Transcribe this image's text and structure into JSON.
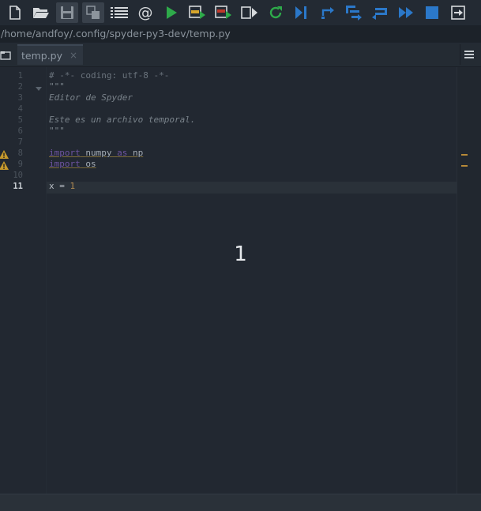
{
  "path": "/home/andfoy/.config/spyder-py3-dev/temp.py",
  "tab": {
    "label": "temp.py",
    "close": "×"
  },
  "toolbar": [
    {
      "icon": "new-file-icon",
      "color": "#d6d9dc"
    },
    {
      "icon": "open-folder-icon",
      "color": "#d6d9dc"
    },
    {
      "icon": "save-icon",
      "color": "#8c949c"
    },
    {
      "icon": "save-all-icon",
      "color": "#8c949c"
    },
    {
      "icon": "outline-list-icon",
      "color": "#d6d9dc"
    },
    {
      "icon": "at-sign-icon",
      "color": "#d6d9dc"
    },
    {
      "icon": "run-icon",
      "color": "#2eaa4a"
    },
    {
      "icon": "run-cell-icon",
      "color": "#2eaa4a"
    },
    {
      "icon": "run-cell-advance-icon",
      "color": "#c0392b"
    },
    {
      "icon": "run-selection-icon",
      "color": "#8c949c"
    },
    {
      "icon": "rerun-icon",
      "color": "#2eaa4a"
    },
    {
      "icon": "debug-icon",
      "color": "#2b78c9"
    },
    {
      "icon": "step-icon",
      "color": "#2b78c9"
    },
    {
      "icon": "step-into-icon",
      "color": "#2b78c9"
    },
    {
      "icon": "step-return-icon",
      "color": "#2b78c9"
    },
    {
      "icon": "continue-icon",
      "color": "#2b78c9"
    },
    {
      "icon": "stop-icon",
      "color": "#2b78c9"
    },
    {
      "icon": "maximize-icon",
      "color": "#d6d9dc"
    }
  ],
  "code": {
    "current_line": "11",
    "line_numbers": [
      "1",
      "2",
      "3",
      "4",
      "5",
      "6",
      "7",
      "8",
      "9",
      "10",
      "11"
    ],
    "line1": "# -*- coding: utf-8 -*-",
    "line2": "\"\"\"",
    "line3": "Editor de Spyder",
    "line5": "Este es un archivo temporal.",
    "line6": "\"\"\"",
    "line8": {
      "kw": "import",
      "mod": "numpy",
      "as": "as",
      "alias": "np"
    },
    "line9": {
      "kw": "import",
      "mod": "os"
    },
    "line11": {
      "var": "x",
      "op": " = ",
      "val": "1"
    }
  },
  "overlay": "1"
}
